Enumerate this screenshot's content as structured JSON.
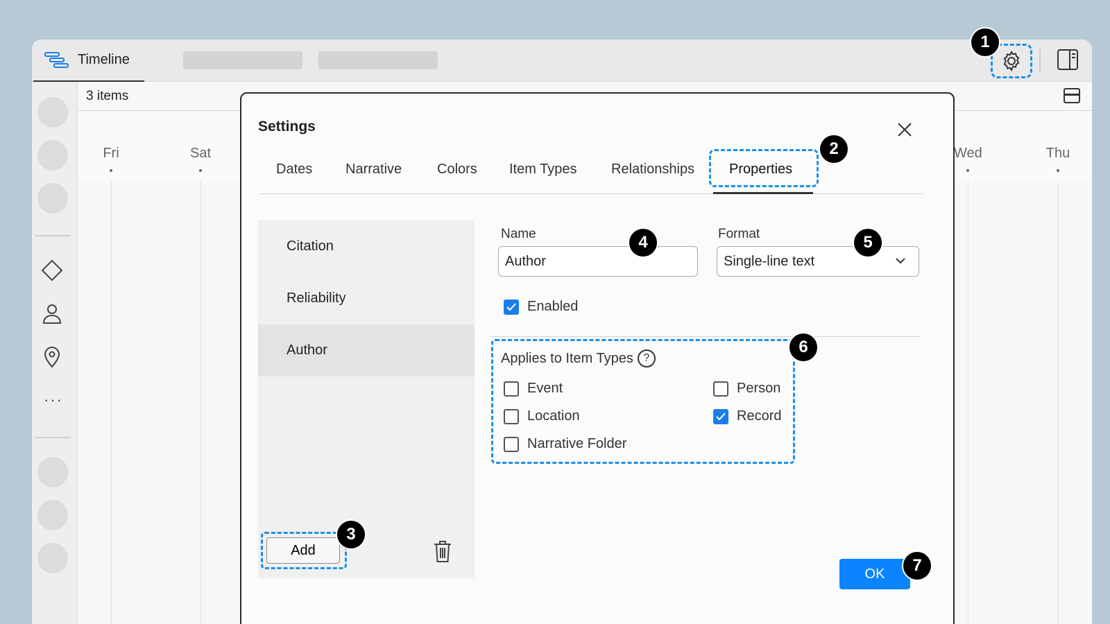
{
  "header": {
    "app_tab_label": "Timeline",
    "settings_icon": "gear-icon",
    "panel_icon": "panel-toggle-icon"
  },
  "toolbar": {
    "items_count": "3 items"
  },
  "timeline": {
    "days": [
      "Fri",
      "Sat",
      "Wed",
      "Thu"
    ]
  },
  "sidebar": {
    "icons": [
      "diamond-icon",
      "person-icon",
      "location-pin-icon",
      "more-icon"
    ]
  },
  "dialog": {
    "title": "Settings",
    "tabs": [
      "Dates",
      "Narrative",
      "Colors",
      "Item Types",
      "Relationships",
      "Properties"
    ],
    "active_tab": "Properties",
    "properties": [
      "Citation",
      "Reliability",
      "Author"
    ],
    "selected_property": "Author",
    "add_label": "Add",
    "name_label": "Name",
    "name_value": "Author",
    "format_label": "Format",
    "format_value": "Single-line text",
    "enabled_label": "Enabled",
    "enabled": true,
    "applies_label": "Applies to Item Types",
    "help_glyph": "?",
    "item_types": [
      {
        "label": "Event",
        "checked": false
      },
      {
        "label": "Person",
        "checked": false
      },
      {
        "label": "Location",
        "checked": false
      },
      {
        "label": "Record",
        "checked": true
      },
      {
        "label": "Narrative Folder",
        "checked": false
      }
    ],
    "ok_label": "OK"
  },
  "callouts": [
    "1",
    "2",
    "3",
    "4",
    "5",
    "6",
    "7"
  ],
  "colors": {
    "accent": "#0a84ff",
    "callout_border": "#1a90e8",
    "background": "#b8c9d6"
  }
}
